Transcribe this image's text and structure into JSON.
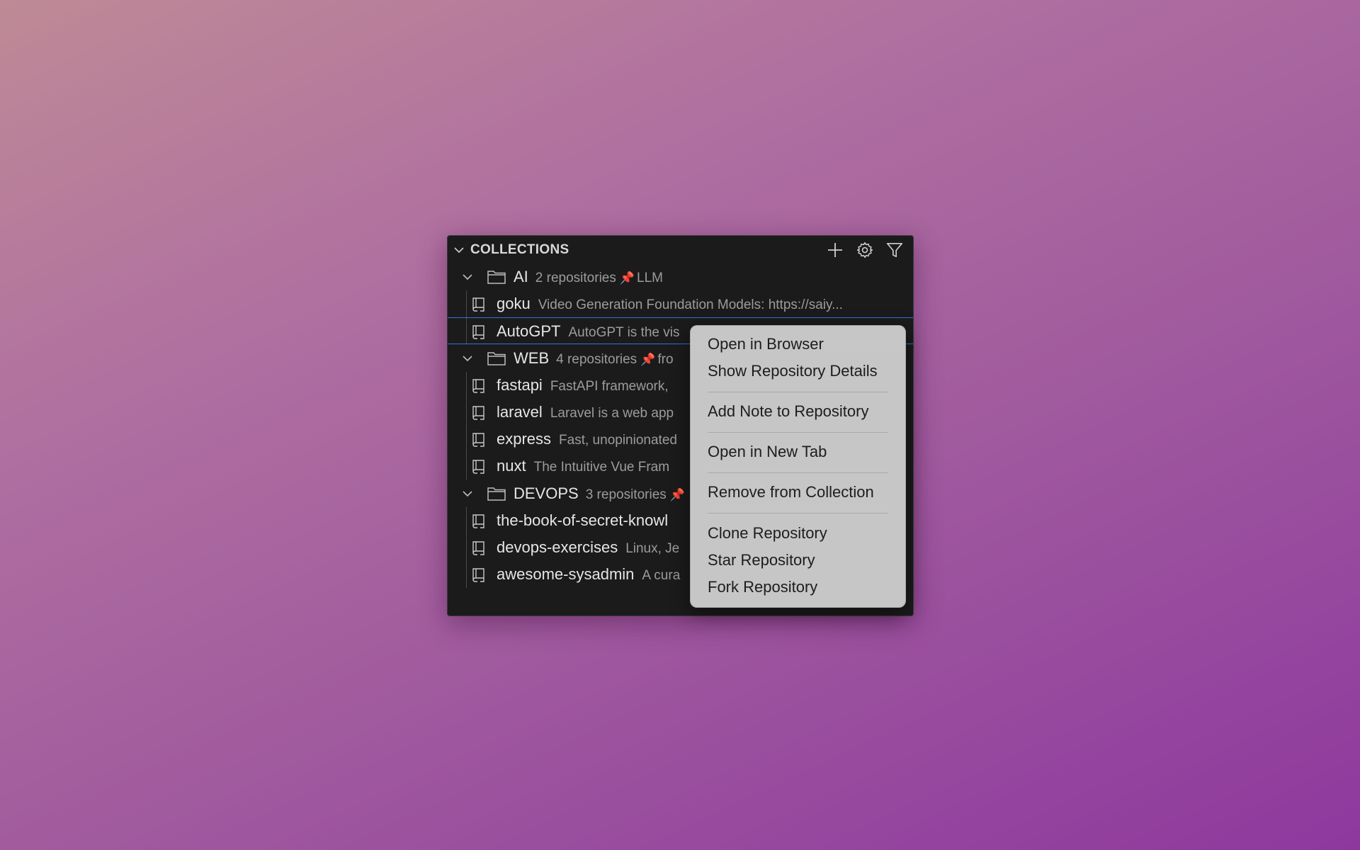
{
  "panel": {
    "title": "COLLECTIONS",
    "actions": [
      "plus-icon",
      "gear-icon",
      "filter-icon"
    ]
  },
  "tree": {
    "ai": {
      "name": "AI",
      "count": "2 repositories",
      "pin": "📌",
      "note": "LLM",
      "repos": [
        {
          "name": "goku",
          "desc": "Video Generation Foundation Models: https://saiy..."
        },
        {
          "name": "AutoGPT",
          "desc": "AutoGPT is the vis"
        }
      ]
    },
    "web": {
      "name": "WEB",
      "count": "4 repositories",
      "pin": "📌",
      "note": "fro",
      "repos": [
        {
          "name": "fastapi",
          "desc": "FastAPI framework,"
        },
        {
          "name": "laravel",
          "desc": "Laravel is a web app"
        },
        {
          "name": "express",
          "desc": "Fast, unopinionated"
        },
        {
          "name": "nuxt",
          "desc": "The Intuitive Vue Fram"
        }
      ]
    },
    "devops": {
      "name": "DEVOPS",
      "count": "3 repositories",
      "pin": "📌",
      "repos": [
        {
          "name": "the-book-of-secret-knowl",
          "desc": ""
        },
        {
          "name": "devops-exercises",
          "desc": "Linux, Je"
        },
        {
          "name": "awesome-sysadmin",
          "desc": "A cura"
        }
      ]
    }
  },
  "context_menu": {
    "open_browser": "Open in Browser",
    "show_details": "Show Repository Details",
    "add_note": "Add Note to Repository",
    "open_tab": "Open in New Tab",
    "remove": "Remove from Collection",
    "clone": "Clone Repository",
    "star": "Star Repository",
    "fork": "Fork Repository"
  },
  "colors": {
    "selection_border": "#2a78d6",
    "pin": "#d03535",
    "menu_bg": "#cccccc"
  }
}
